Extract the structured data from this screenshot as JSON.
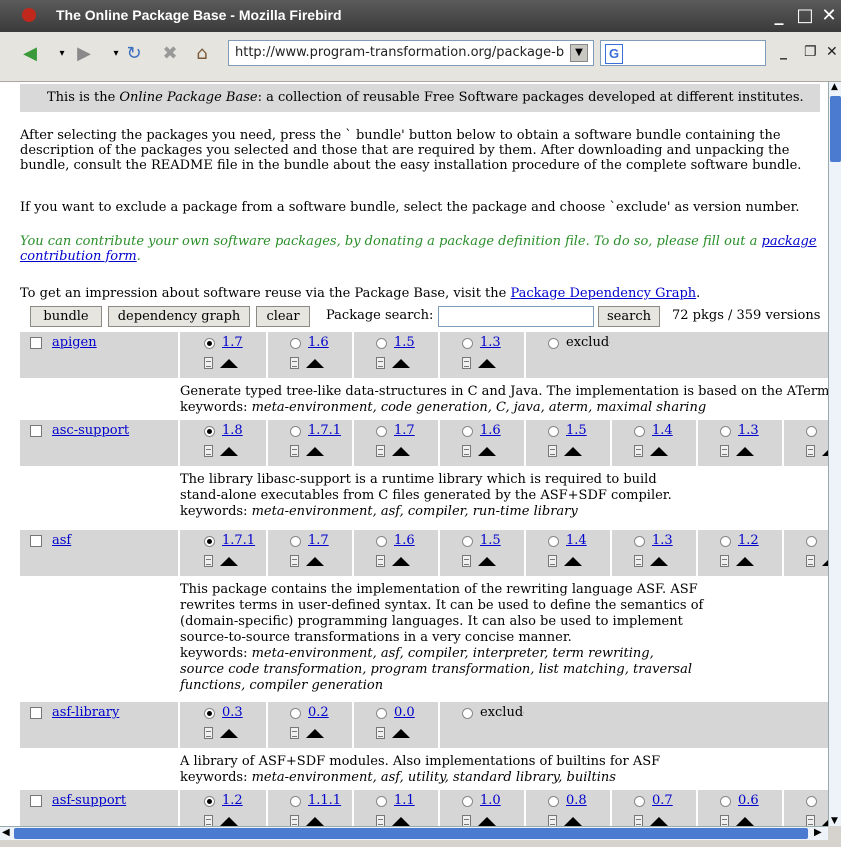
{
  "window": {
    "title": "The Online Package Base - Mozilla Firebird"
  },
  "toolbar": {
    "url": "http://www.program-transformation.org/package-b",
    "search_logo": "G",
    "nav_icons": [
      "back-arrow-icon",
      "forward-arrow-icon",
      "reload-icon",
      "stop-icon",
      "home-icon"
    ]
  },
  "content": {
    "intro_prefix": "This is the ",
    "intro_italic": "Online Package Base",
    "intro_suffix": ": a collection of reusable Free Software packages developed at different institutes.",
    "para1": "After selecting the packages you need, press the ` bundle' button below to obtain a software bundle containing the description of the packages you selected and those that are required by them. After downloading and unpacking the bundle, consult the README file in the bundle about the easy installation procedure of the complete software bundle.",
    "para2": "If you want to exclude a package from a software bundle, select the package and choose `exclude' as version number.",
    "contrib_text": "You can contribute your own software packages, by donating a package definition file. To do so, please fill out a ",
    "contrib_link": "package contribution form",
    "contrib_end": ".",
    "graph_text": "To get an impression about software reuse via the Package Base, visit the ",
    "graph_link": "Package Dependency Graph",
    "graph_end": "."
  },
  "controls": {
    "bundle": "bundle",
    "dependency_graph": "dependency graph",
    "clear": "clear",
    "search_label": "Package search:",
    "search_button": "search",
    "stats": "72 pkgs / 359 versions"
  },
  "packages": [
    {
      "name": "apigen",
      "versions": [
        "1.7",
        "1.6",
        "1.5",
        "1.3"
      ],
      "selected": "1.7",
      "exclude": true,
      "desc": [
        "Generate typed tree-like data-structures in C and Java. The implementation is based on the ATerm li"
      ],
      "keywords_label": "keywords: ",
      "keywords": "meta-environment, code generation, C, java, aterm, maximal sharing"
    },
    {
      "name": "asc-support",
      "versions": [
        "1.8",
        "1.7.1",
        "1.7",
        "1.6",
        "1.5",
        "1.4",
        "1.3",
        ""
      ],
      "selected": "1.8",
      "exclude": false,
      "desc": [
        "The library libasc-support is a runtime library which is required to build",
        "stand-alone executables from C files generated by the ASF+SDF compiler."
      ],
      "keywords_label": "keywords: ",
      "keywords": "meta-environment, asf, compiler, run-time library"
    },
    {
      "name": "asf",
      "versions": [
        "1.7.1",
        "1.7",
        "1.6",
        "1.5",
        "1.4",
        "1.3",
        "1.2",
        ""
      ],
      "selected": "1.7.1",
      "exclude": false,
      "desc": [
        "This package contains the implementation of the rewriting language ASF. ASF",
        "rewrites terms in user-defined syntax. It can be used to define the semantics of",
        "(domain-specific) programming languages. It can also be used to implement",
        "source-to-source transformations in a very concise manner."
      ],
      "keywords_label": "keywords: ",
      "keywords": "meta-environment, asf, compiler, interpreter, term rewriting,",
      "keywords_more": [
        "source code transformation, program transformation, list matching, traversal",
        "functions, compiler generation"
      ]
    },
    {
      "name": "asf-library",
      "versions": [
        "0.3",
        "0.2",
        "0.0"
      ],
      "selected": "0.3",
      "exclude": true,
      "desc": [
        "A library of ASF+SDF modules. Also implementations of builtins for ASF"
      ],
      "keywords_label": "keywords: ",
      "keywords": "meta-environment, asf, utility, standard library, builtins"
    },
    {
      "name": "asf-support",
      "versions": [
        "1.2",
        "1.1.1",
        "1.1",
        "1.0",
        "0.8",
        "0.7",
        "0.6",
        ""
      ],
      "selected": "1.2",
      "exclude": false,
      "desc": [],
      "keywords_label": "",
      "keywords": ""
    }
  ],
  "exclude_label": "exclude"
}
